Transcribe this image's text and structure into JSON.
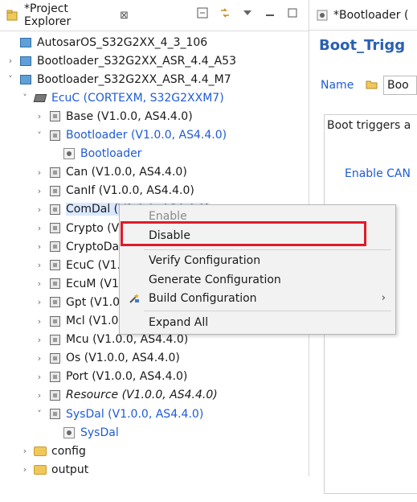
{
  "project_explorer": {
    "tab_title": "*Project Explorer",
    "close_glyph": "⊠",
    "tree": [
      {
        "label": "AutosarOS_S32G2XX_4_3_106",
        "indent": 0,
        "chevron": "",
        "icon": "project-icon",
        "style": "normal"
      },
      {
        "label": "Bootloader_S32G2XX_ASR_4.4_A53",
        "indent": 0,
        "chevron": "›",
        "icon": "project-icon",
        "style": "normal"
      },
      {
        "label": "Bootloader_S32G2XX_ASR_4.4_M7",
        "indent": 0,
        "chevron": "˅",
        "icon": "project-icon",
        "style": "normal"
      },
      {
        "label": "EcuC (CORTEXM, S32G2XXM7)",
        "indent": 1,
        "chevron": "˅",
        "icon": "ecu-chip-icon",
        "style": "blue"
      },
      {
        "label": "Base (V1.0.0, AS4.4.0)",
        "indent": 2,
        "chevron": "›",
        "icon": "module-icon",
        "style": "normal"
      },
      {
        "label": "Bootloader (V1.0.0, AS4.4.0)",
        "indent": 2,
        "chevron": "˅",
        "icon": "module-icon",
        "style": "blue"
      },
      {
        "label": "Bootloader",
        "indent": 3,
        "chevron": "",
        "icon": "config-icon",
        "style": "blue"
      },
      {
        "label": "Can (V1.0.0, AS4.4.0)",
        "indent": 2,
        "chevron": "›",
        "icon": "module-icon",
        "style": "normal"
      },
      {
        "label": "CanIf (V1.0.0, AS4.4.0)",
        "indent": 2,
        "chevron": "›",
        "icon": "module-icon",
        "style": "normal"
      },
      {
        "label": "ComDal (V1.0.0, AS4.4.0)",
        "indent": 2,
        "chevron": "›",
        "icon": "module-icon",
        "style": "selected"
      },
      {
        "label": "Crypto (V",
        "indent": 2,
        "chevron": "›",
        "icon": "module-icon",
        "style": "normal"
      },
      {
        "label": "CryptoDa",
        "indent": 2,
        "chevron": "›",
        "icon": "module-icon",
        "style": "normal"
      },
      {
        "label": "EcuC (V1.",
        "indent": 2,
        "chevron": "›",
        "icon": "module-icon",
        "style": "normal"
      },
      {
        "label": "EcuM (V1",
        "indent": 2,
        "chevron": "›",
        "icon": "module-icon",
        "style": "normal"
      },
      {
        "label": "Gpt (V1.0",
        "indent": 2,
        "chevron": "›",
        "icon": "module-icon",
        "style": "normal"
      },
      {
        "label": "Mcl (V1.0",
        "indent": 2,
        "chevron": "›",
        "icon": "module-icon",
        "style": "normal"
      },
      {
        "label": "Mcu (V1.0.0, AS4.4.0)",
        "indent": 2,
        "chevron": "›",
        "icon": "module-icon",
        "style": "normal"
      },
      {
        "label": "Os (V1.0.0, AS4.4.0)",
        "indent": 2,
        "chevron": "›",
        "icon": "module-icon",
        "style": "normal"
      },
      {
        "label": "Port (V1.0.0, AS4.4.0)",
        "indent": 2,
        "chevron": "›",
        "icon": "module-icon",
        "style": "normal"
      },
      {
        "label": "Resource (V1.0.0, AS4.4.0)",
        "indent": 2,
        "chevron": "›",
        "icon": "module-icon",
        "style": "italic"
      },
      {
        "label": "SysDal (V1.0.0, AS4.4.0)",
        "indent": 2,
        "chevron": "˅",
        "icon": "module-icon",
        "style": "blue"
      },
      {
        "label": "SysDal",
        "indent": 3,
        "chevron": "",
        "icon": "config-icon",
        "style": "blue"
      },
      {
        "label": "config",
        "indent": 1,
        "chevron": "›",
        "icon": "folder-icon",
        "style": "normal"
      },
      {
        "label": "output",
        "indent": 1,
        "chevron": "›",
        "icon": "folder-icon",
        "style": "normal"
      }
    ]
  },
  "editor": {
    "tab_title": "*Bootloader (",
    "title": "Boot_Trigg",
    "name_label": "Name",
    "name_value": "Boo",
    "group_title": "Boot triggers a",
    "enable_label": "Enable CAN"
  },
  "context_menu": {
    "items": [
      {
        "label": "Enable",
        "enabled": false
      },
      {
        "label": "Disable",
        "enabled": true
      },
      {
        "label": "Verify Configuration",
        "enabled": true
      },
      {
        "label": "Generate Configuration",
        "enabled": true
      },
      {
        "label": "Build Configuration",
        "enabled": true,
        "submenu": true
      },
      {
        "label": "Expand All",
        "enabled": true
      }
    ],
    "submenu_arrow": "›"
  }
}
